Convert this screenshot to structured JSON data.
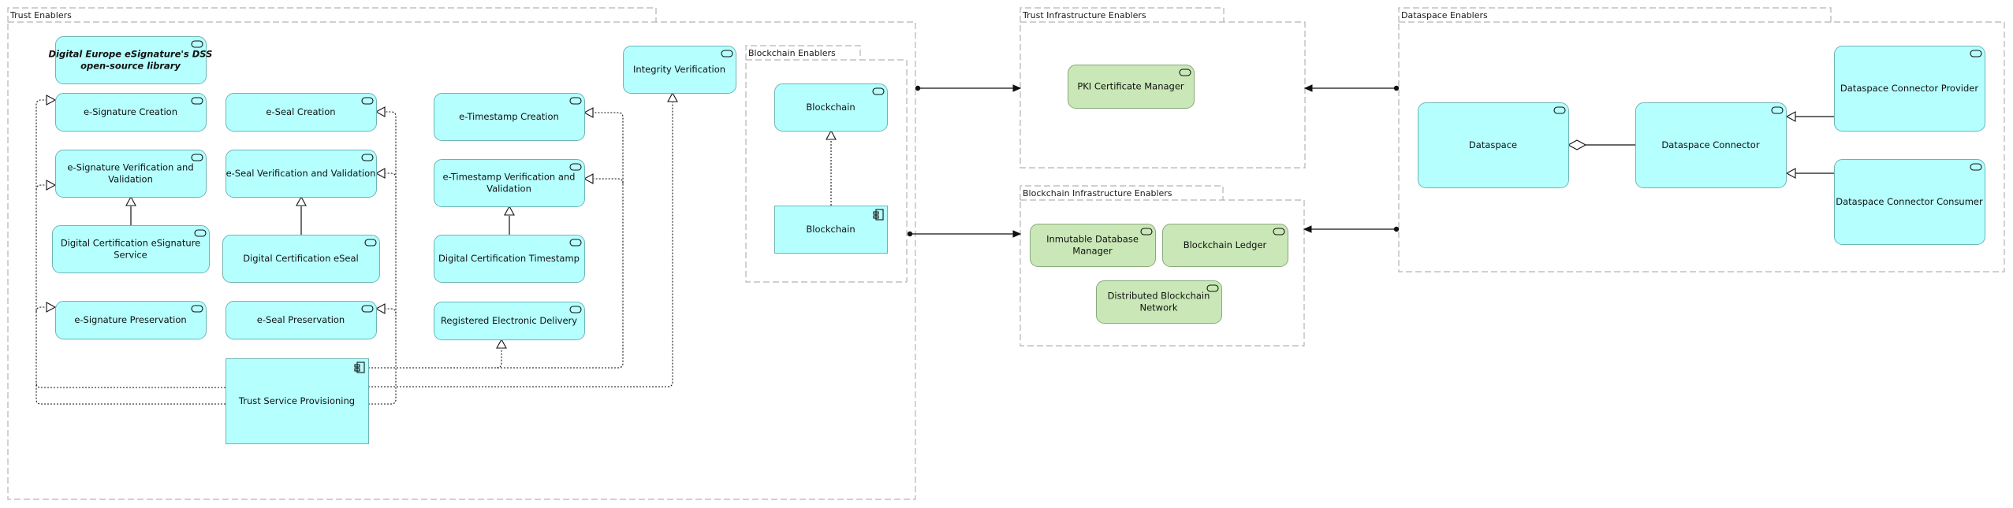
{
  "diagram": {
    "groups": [
      {
        "id": "trust-enablers",
        "label": "Trust Enablers"
      },
      {
        "id": "blockchain-enablers",
        "label": "Blockchain Enablers"
      },
      {
        "id": "trust-infrastructure-enablers",
        "label": "Trust Infrastructure Enablers"
      },
      {
        "id": "blockchain-infrastructure-enablers",
        "label": "Blockchain Infrastructure Enablers"
      },
      {
        "id": "dataspace-enablers",
        "label": "Dataspace Enablers"
      }
    ],
    "nodes": [
      {
        "id": "dss-library",
        "label": "Digital Europe eSignature's DSS open-source library",
        "lines": [
          "Digital Europe eSignature's DSS",
          "open-source library"
        ],
        "type": "service",
        "style": "bold-italic",
        "color": "#b5ffff"
      },
      {
        "id": "esig-creation",
        "label": "e-Signature Creation",
        "lines": [
          "e-Signature Creation"
        ],
        "type": "service",
        "color": "#b5ffff"
      },
      {
        "id": "esig-verification",
        "label": "e-Signature Verification and Validation",
        "lines": [
          "e-Signature Verification and",
          "Validation"
        ],
        "type": "service",
        "color": "#b5ffff"
      },
      {
        "id": "dc-esig-service",
        "label": "Digital Certification eSignature Service",
        "lines": [
          "Digital Certification eSignature",
          "Service"
        ],
        "type": "service",
        "color": "#b5ffff"
      },
      {
        "id": "esig-preservation",
        "label": "e-Signature Preservation",
        "lines": [
          "e-Signature Preservation"
        ],
        "type": "service",
        "color": "#b5ffff"
      },
      {
        "id": "eseal-creation",
        "label": "e-Seal Creation",
        "lines": [
          "e-Seal Creation"
        ],
        "type": "service",
        "color": "#b5ffff"
      },
      {
        "id": "eseal-verification",
        "label": "e-Seal Verification and Validation",
        "lines": [
          "e-Seal Verification and Validation"
        ],
        "type": "service",
        "color": "#b5ffff"
      },
      {
        "id": "dc-eseal",
        "label": "Digital Certification eSeal",
        "lines": [
          "Digital Certification eSeal"
        ],
        "type": "service",
        "color": "#b5ffff"
      },
      {
        "id": "eseal-preservation",
        "label": "e-Seal Preservation",
        "lines": [
          "e-Seal Preservation"
        ],
        "type": "service",
        "color": "#b5ffff"
      },
      {
        "id": "trust-service-provisioning",
        "label": "Trust Service Provisioning",
        "lines": [
          "Trust Service Provisioning"
        ],
        "type": "component",
        "color": "#b5ffff"
      },
      {
        "id": "ets-creation",
        "label": "e-Timestamp Creation",
        "lines": [
          "e-Timestamp Creation"
        ],
        "type": "service",
        "color": "#b5ffff"
      },
      {
        "id": "ets-verification",
        "label": "e-Timestamp Verification and Validation",
        "lines": [
          "e-Timestamp Verification and",
          "Validation"
        ],
        "type": "service",
        "color": "#b5ffff"
      },
      {
        "id": "dc-timestamp",
        "label": "Digital Certification Timestamp",
        "lines": [
          "Digital Certification Timestamp"
        ],
        "type": "service",
        "color": "#b5ffff"
      },
      {
        "id": "registered-delivery",
        "label": "Registered Electronic Delivery",
        "lines": [
          "Registered Electronic Delivery"
        ],
        "type": "service",
        "color": "#b5ffff"
      },
      {
        "id": "integrity-verification",
        "label": "Integrity Verification",
        "lines": [
          "Integrity Verification"
        ],
        "type": "service",
        "color": "#b5ffff"
      },
      {
        "id": "blockchain-service",
        "label": "Blockchain",
        "lines": [
          "Blockchain"
        ],
        "type": "service",
        "color": "#b5ffff"
      },
      {
        "id": "blockchain-component",
        "label": "Blockchain",
        "lines": [
          "Blockchain"
        ],
        "type": "component",
        "color": "#b5ffff"
      },
      {
        "id": "pki-cert-manager",
        "label": "PKI Certificate Manager",
        "lines": [
          "PKI Certificate Manager"
        ],
        "type": "service",
        "color": "#c9e7b7"
      },
      {
        "id": "inmutable-db-manager",
        "label": "Inmutable Database Manager",
        "lines": [
          "Inmutable Database",
          "Manager"
        ],
        "type": "service",
        "color": "#c9e7b7"
      },
      {
        "id": "blockchain-ledger",
        "label": "Blockchain Ledger",
        "lines": [
          "Blockchain Ledger"
        ],
        "type": "service",
        "color": "#c9e7b7"
      },
      {
        "id": "distributed-blockchain-network",
        "label": "Distributed Blockchain Network",
        "lines": [
          "Distributed Blockchain",
          "Network"
        ],
        "type": "service",
        "color": "#c9e7b7"
      },
      {
        "id": "dataspace",
        "label": "Dataspace",
        "lines": [
          "Dataspace"
        ],
        "type": "service",
        "color": "#b5ffff"
      },
      {
        "id": "dataspace-connector",
        "label": "Dataspace Connector",
        "lines": [
          "Dataspace Connector"
        ],
        "type": "service",
        "color": "#b5ffff"
      },
      {
        "id": "dataspace-connector-provider",
        "label": "Dataspace Connector Provider",
        "lines": [
          "Dataspace Connector Provider"
        ],
        "type": "service",
        "color": "#b5ffff"
      },
      {
        "id": "dataspace-connector-consumer",
        "label": "Dataspace Connector Consumer",
        "lines": [
          "Dataspace Connector Consumer"
        ],
        "type": "service",
        "color": "#b5ffff"
      }
    ],
    "relations": [
      {
        "id": "r1",
        "type": "realization",
        "from": "trust-service-provisioning",
        "to": "esig-creation"
      },
      {
        "id": "r2",
        "type": "realization",
        "from": "trust-service-provisioning",
        "to": "esig-verification"
      },
      {
        "id": "r3",
        "type": "realization",
        "from": "trust-service-provisioning",
        "to": "esig-preservation"
      },
      {
        "id": "r4",
        "type": "realization",
        "from": "trust-service-provisioning",
        "to": "eseal-creation"
      },
      {
        "id": "r5",
        "type": "realization",
        "from": "trust-service-provisioning",
        "to": "eseal-verification"
      },
      {
        "id": "r6",
        "type": "realization",
        "from": "trust-service-provisioning",
        "to": "eseal-preservation"
      },
      {
        "id": "r7",
        "type": "realization",
        "from": "trust-service-provisioning",
        "to": "ets-creation"
      },
      {
        "id": "r8",
        "type": "realization",
        "from": "trust-service-provisioning",
        "to": "ets-verification"
      },
      {
        "id": "r9",
        "type": "realization",
        "from": "trust-service-provisioning",
        "to": "registered-delivery"
      },
      {
        "id": "r10",
        "type": "realization",
        "from": "trust-service-provisioning",
        "to": "integrity-verification"
      },
      {
        "id": "r11",
        "type": "specialization",
        "from": "dc-esig-service",
        "to": "esig-verification"
      },
      {
        "id": "r12",
        "type": "specialization",
        "from": "dc-eseal",
        "to": "eseal-verification"
      },
      {
        "id": "r13",
        "type": "specialization",
        "from": "dc-timestamp",
        "to": "ets-verification"
      },
      {
        "id": "r14",
        "type": "realization",
        "from": "blockchain-component",
        "to": "blockchain-service"
      },
      {
        "id": "r15",
        "type": "serving",
        "from": "trust-enablers",
        "to": "trust-infrastructure-enablers"
      },
      {
        "id": "r16",
        "type": "serving",
        "from": "blockchain-enablers",
        "to": "blockchain-infrastructure-enablers"
      },
      {
        "id": "r17",
        "type": "serving",
        "from": "dataspace-enablers",
        "to": "trust-infrastructure-enablers"
      },
      {
        "id": "r18",
        "type": "serving",
        "from": "dataspace-enablers",
        "to": "blockchain-infrastructure-enablers"
      },
      {
        "id": "r19",
        "type": "aggregation",
        "from": "dataspace",
        "to": "dataspace-connector"
      },
      {
        "id": "r20",
        "type": "specialization",
        "from": "dataspace-connector-provider",
        "to": "dataspace-connector"
      },
      {
        "id": "r21",
        "type": "specialization",
        "from": "dataspace-connector-consumer",
        "to": "dataspace-connector"
      }
    ]
  }
}
